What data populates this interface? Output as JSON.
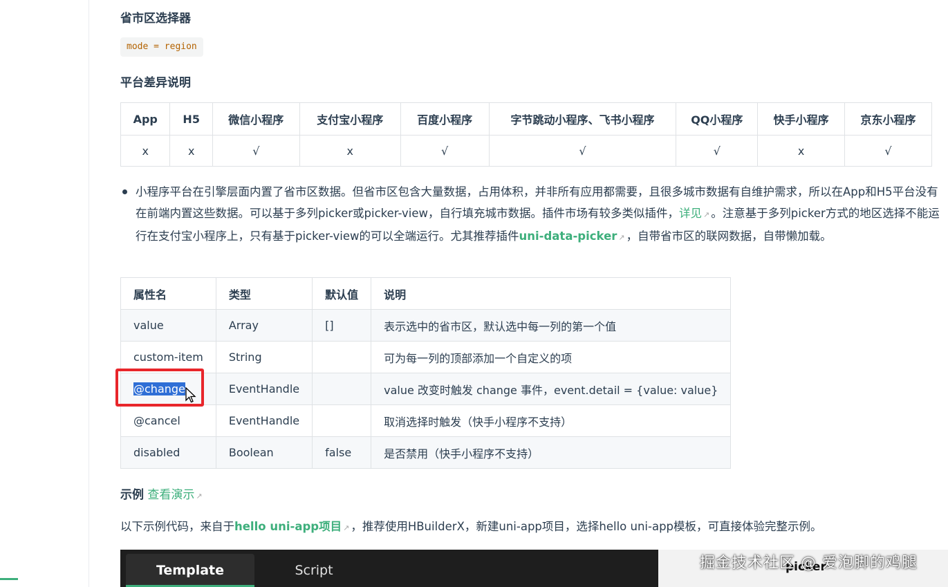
{
  "section_title": "省市区选择器",
  "mode_code": "mode = region",
  "platform_title": "平台差异说明",
  "platform_table": {
    "headers": [
      "App",
      "H5",
      "微信小程序",
      "支付宝小程序",
      "百度小程序",
      "字节跳动小程序、飞书小程序",
      "QQ小程序",
      "快手小程序",
      "京东小程序"
    ],
    "values": [
      "x",
      "x",
      "√",
      "x",
      "√",
      "√",
      "√",
      "x",
      "√"
    ]
  },
  "bullet": {
    "part1": "小程序平台在引擎层面内置了省市区数据。但省市区包含大量数据，占用体积，并非所有应用都需要，且很多城市数据有自维护需求，所以在App和H5平台没有在前端内置这些数据。可以基于多列picker或picker-view，自行填充城市数据。插件市场有较多类似插件，",
    "link1": "详见",
    "part2": "。注意基于多列picker方式的地区选择不能运行在支付宝小程序上，只有基于picker-view的可以全端运行。尤其推荐插件",
    "link2": "uni-data-picker",
    "part3": "，自带省市区的联网数据，自带懒加载。"
  },
  "props_table": {
    "headers": [
      "属性名",
      "类型",
      "默认值",
      "说明"
    ],
    "rows": [
      [
        "value",
        "Array",
        "[]",
        "表示选中的省市区，默认选中每一列的第一个值"
      ],
      [
        "custom-item",
        "String",
        "",
        "可为每一列的顶部添加一个自定义的项"
      ],
      [
        "@change",
        "EventHandle",
        "",
        "value 改变时触发 change 事件，event.detail = {value: value}"
      ],
      [
        "@cancel",
        "EventHandle",
        "",
        "取消选择时触发（快手小程序不支持）"
      ],
      [
        "disabled",
        "Boolean",
        "false",
        "是否禁用（快手小程序不支持）"
      ]
    ]
  },
  "example": {
    "label": "示例",
    "link": "查看演示"
  },
  "intro": {
    "part1": "以下示例代码，来自于",
    "link": "hello uni-app项目",
    "part2": "，推荐使用HBuilderX，新建uni-app项目，选择hello uni-app模板，可直接体验完整示例。"
  },
  "code_tabs": [
    "Template",
    "Script"
  ],
  "right_label": "picker",
  "watermark": "掘金技术社区 @ 爱泡脚的鸡腿",
  "colors": {
    "link": "#3eaf7c",
    "highlight": "#e8262b",
    "selection": "#2f6fd6"
  }
}
